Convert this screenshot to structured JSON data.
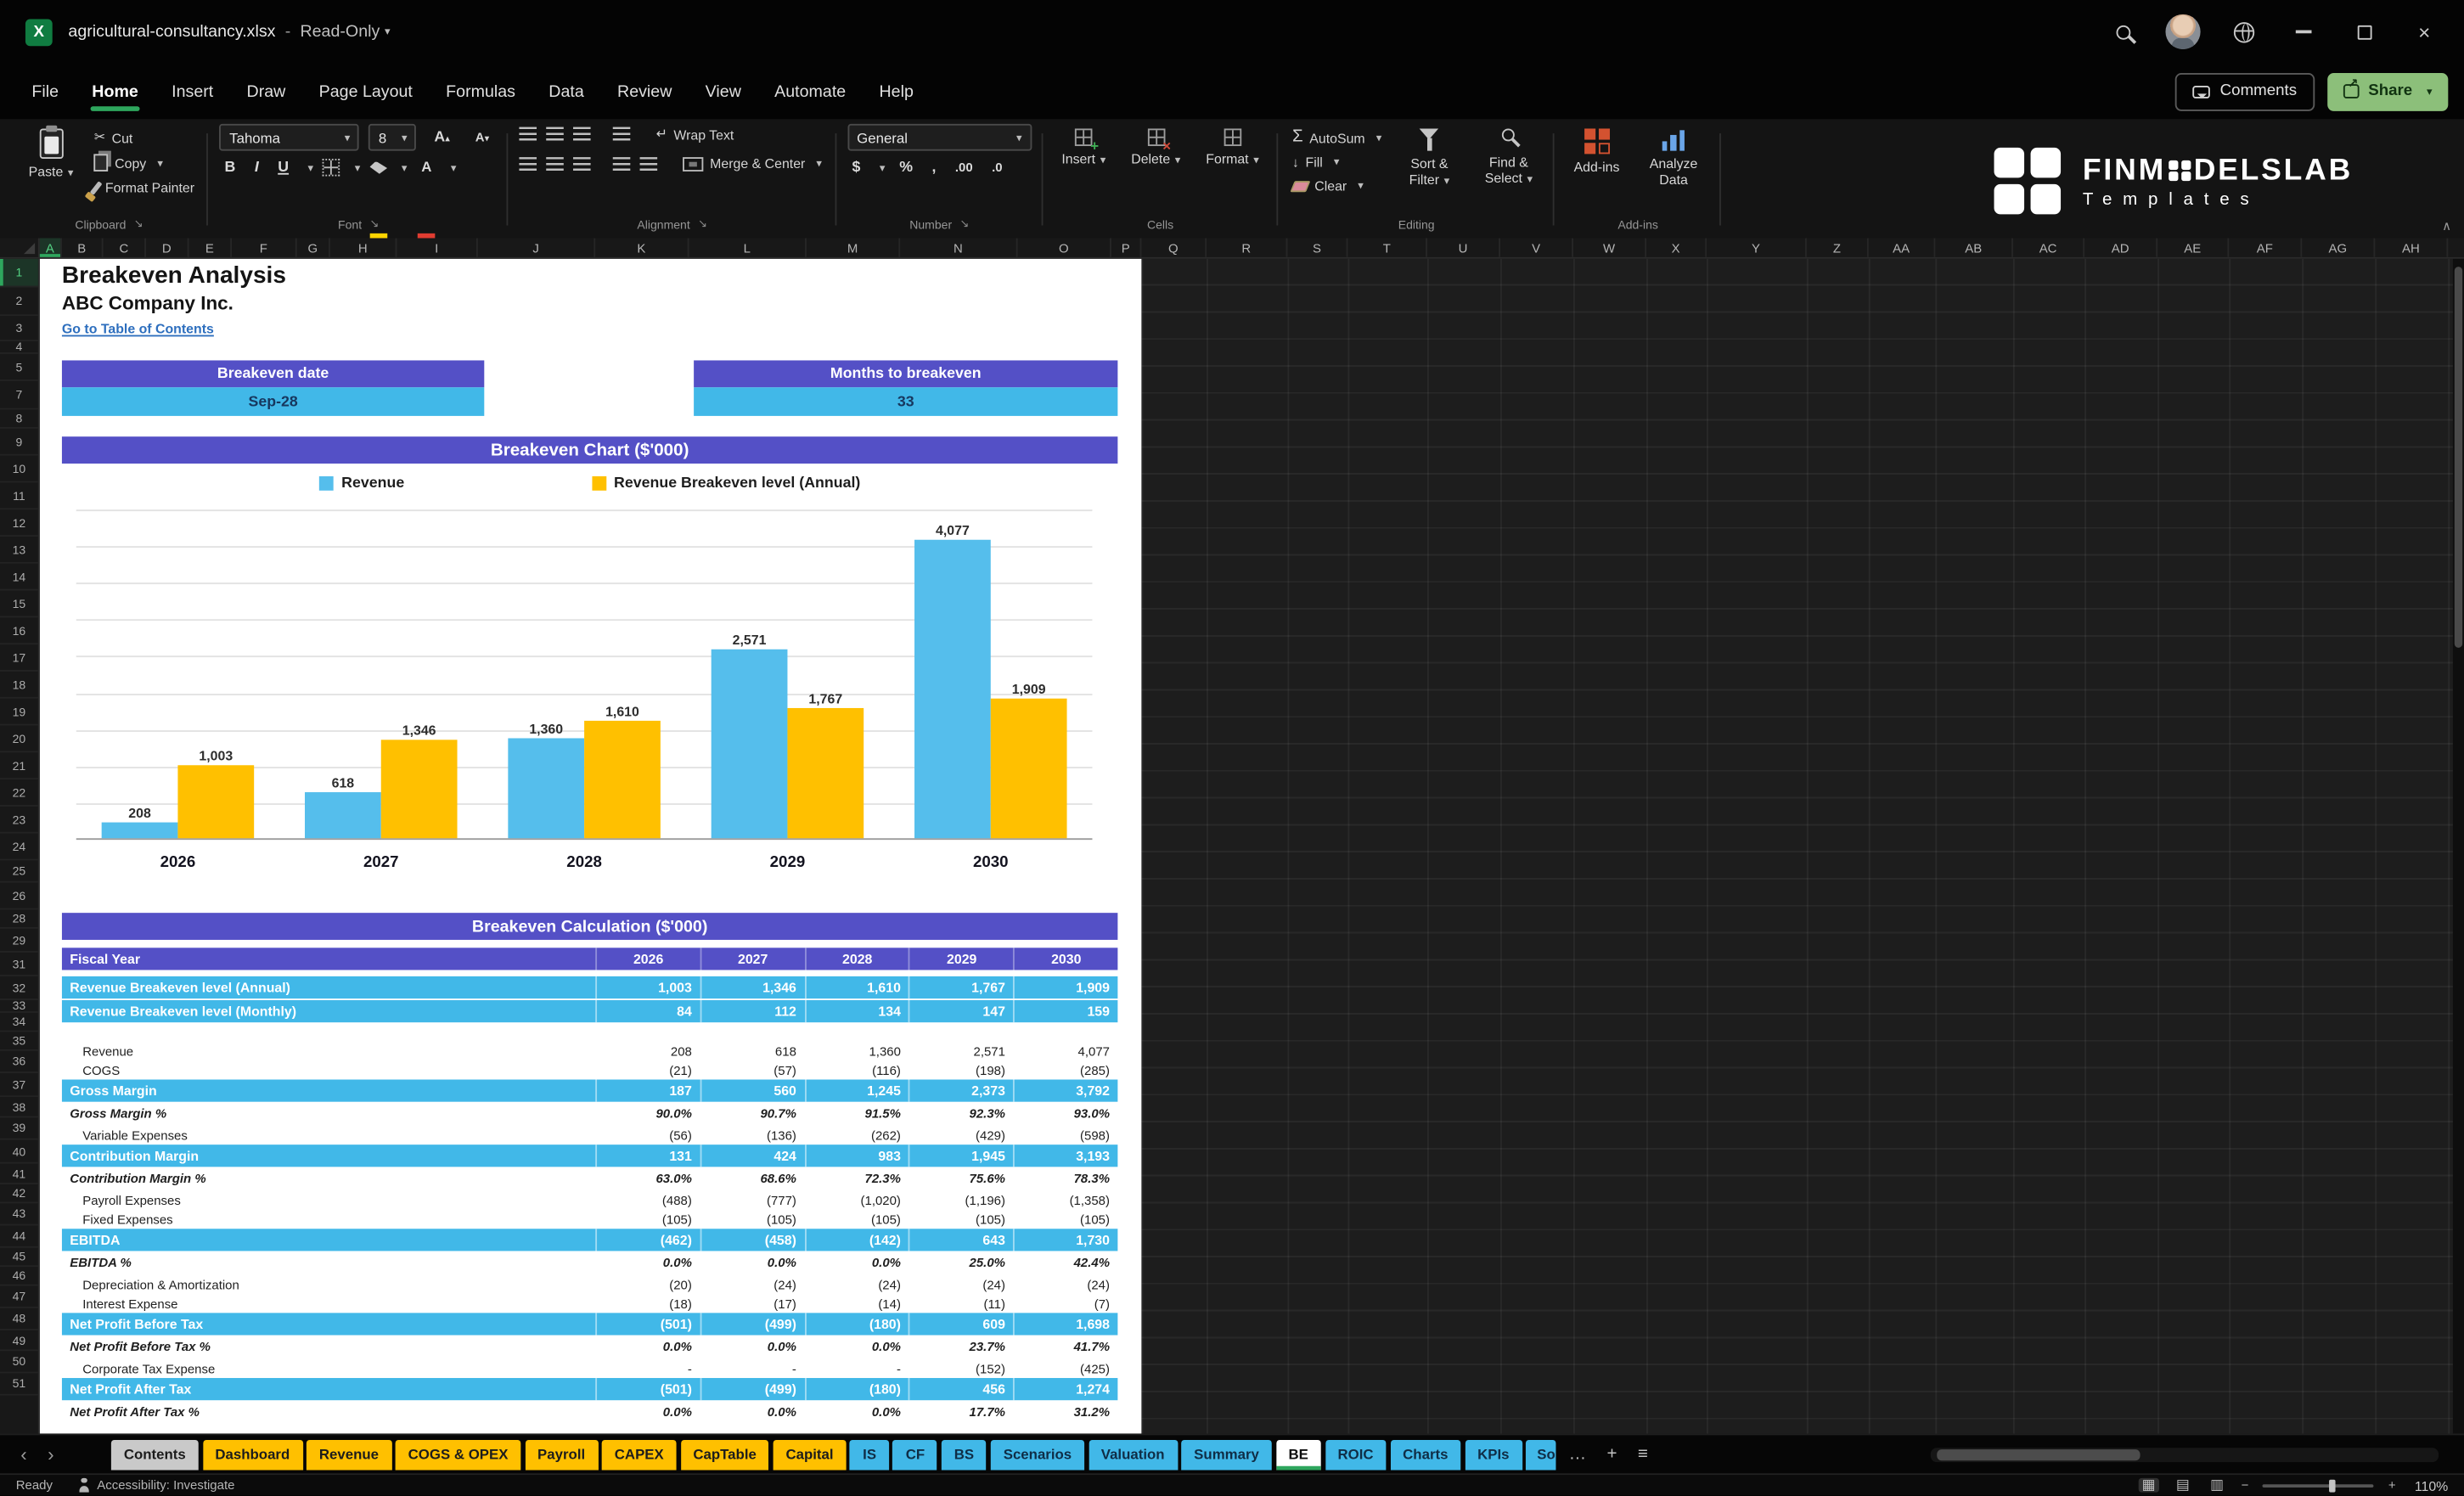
{
  "titlebar": {
    "app_icon_letter": "X",
    "filename": "agricultural-consultancy.xlsx",
    "separator": "-",
    "mode": "Read-Only"
  },
  "icons": {
    "dropdown": "▾",
    "cut": "✂",
    "autosum": "Σ",
    "fill_arrow": "↓",
    "bold": "B",
    "italic": "I",
    "underline": "U",
    "currency": "$",
    "percent": "%",
    "comma": ",",
    "decrease_decimal": ".0",
    "increase_decimal": ".00",
    "wrap_return": "↵",
    "launcher": "↘",
    "ribbon_collapse": "∧",
    "close": "×",
    "plus": "+",
    "minus": "−",
    "more_tabs": "…",
    "add_sheet": "+",
    "sheet_list": "≡",
    "nav_left": "‹",
    "nav_right": "›",
    "view_normal": "▦",
    "view_layout": "▤",
    "view_break": "▥"
  },
  "menubar": {
    "items": [
      "File",
      "Home",
      "Insert",
      "Draw",
      "Page Layout",
      "Formulas",
      "Data",
      "Review",
      "View",
      "Automate",
      "Help"
    ],
    "active": "Home",
    "comments_label": "Comments",
    "share_label": "Share"
  },
  "ribbon": {
    "clipboard": {
      "label": "Clipboard",
      "paste": "Paste",
      "cut": "Cut",
      "copy": "Copy",
      "format_painter": "Format Painter"
    },
    "font": {
      "label": "Font",
      "font_name": "Tahoma",
      "font_size": "8"
    },
    "alignment": {
      "label": "Alignment",
      "wrap_text": "Wrap Text",
      "merge_center": "Merge & Center"
    },
    "number": {
      "label": "Number",
      "format": "General"
    },
    "cells": {
      "label": "Cells",
      "insert": "Insert",
      "delete": "Delete",
      "format": "Format"
    },
    "editing": {
      "label": "Editing",
      "autosum": "AutoSum",
      "fill": "Fill",
      "clear": "Clear",
      "sort_filter": "Sort & Filter",
      "find_select": "Find & Select"
    },
    "addins": {
      "label": "Add-ins",
      "button": "Add-ins",
      "analyze": "Analyze Data"
    }
  },
  "brand": {
    "part1": "FINM",
    "part2": "DELSLAB",
    "line2": "Templates"
  },
  "grid": {
    "columns": [
      {
        "n": "A",
        "w": 14,
        "selected": true
      },
      {
        "n": "B",
        "w": 26
      },
      {
        "n": "C",
        "w": 27
      },
      {
        "n": "D",
        "w": 27
      },
      {
        "n": "E",
        "w": 27
      },
      {
        "n": "F",
        "w": 41
      },
      {
        "n": "G",
        "w": 21
      },
      {
        "n": "H",
        "w": 42
      },
      {
        "n": "I",
        "w": 51
      },
      {
        "n": "J",
        "w": 74
      },
      {
        "n": "K",
        "w": 59
      },
      {
        "n": "L",
        "w": 74
      },
      {
        "n": "M",
        "w": 59
      },
      {
        "n": "N",
        "w": 74
      },
      {
        "n": "O",
        "w": 59
      },
      {
        "n": "P",
        "w": 19
      },
      {
        "n": "Q",
        "w": 41
      },
      {
        "n": "R",
        "w": 51
      },
      {
        "n": "S",
        "w": 38
      },
      {
        "n": "T",
        "w": 50
      },
      {
        "n": "U",
        "w": 46
      },
      {
        "n": "V",
        "w": 46
      },
      {
        "n": "W",
        "w": 46
      },
      {
        "n": "X",
        "w": 38
      },
      {
        "n": "Y",
        "w": 63
      },
      {
        "n": "Z",
        "w": 39
      },
      {
        "n": "AA",
        "w": 42
      },
      {
        "n": "AB",
        "w": 49
      },
      {
        "n": "AC",
        "w": 45
      },
      {
        "n": "AD",
        "w": 46
      },
      {
        "n": "AE",
        "w": 45
      },
      {
        "n": "AF",
        "w": 46
      },
      {
        "n": "AG",
        "w": 46
      },
      {
        "n": "AH",
        "w": 46
      }
    ],
    "rows": [
      {
        "n": "1",
        "h": 18,
        "selected": true
      },
      {
        "n": "2",
        "h": 18
      },
      {
        "n": "3",
        "h": 16
      },
      {
        "n": "4",
        "h": 8
      },
      {
        "n": "5",
        "h": 17
      },
      {
        "n": "7",
        "h": 18
      },
      {
        "n": "8",
        "h": 12
      },
      {
        "n": "9",
        "h": 17
      },
      {
        "n": "10",
        "h": 17
      },
      {
        "n": "11",
        "h": 17
      },
      {
        "n": "12",
        "h": 17
      },
      {
        "n": "13",
        "h": 17
      },
      {
        "n": "14",
        "h": 17
      },
      {
        "n": "15",
        "h": 17
      },
      {
        "n": "16",
        "h": 17
      },
      {
        "n": "17",
        "h": 17
      },
      {
        "n": "18",
        "h": 17
      },
      {
        "n": "19",
        "h": 17
      },
      {
        "n": "20",
        "h": 17
      },
      {
        "n": "21",
        "h": 17
      },
      {
        "n": "22",
        "h": 17
      },
      {
        "n": "23",
        "h": 17
      },
      {
        "n": "24",
        "h": 17
      },
      {
        "n": "25",
        "h": 14
      },
      {
        "n": "26",
        "h": 17
      },
      {
        "n": "28",
        "h": 12
      },
      {
        "n": "29",
        "h": 15
      },
      {
        "n": "31",
        "h": 15
      },
      {
        "n": "32",
        "h": 15
      },
      {
        "n": "33",
        "h": 8
      },
      {
        "n": "34",
        "h": 12
      },
      {
        "n": "35",
        "h": 12
      },
      {
        "n": "36",
        "h": 14
      },
      {
        "n": "37",
        "h": 15
      },
      {
        "n": "38",
        "h": 13
      },
      {
        "n": "39",
        "h": 14
      },
      {
        "n": "40",
        "h": 15
      },
      {
        "n": "41",
        "h": 13
      },
      {
        "n": "42",
        "h": 12
      },
      {
        "n": "43",
        "h": 14
      },
      {
        "n": "44",
        "h": 14
      },
      {
        "n": "45",
        "h": 12
      },
      {
        "n": "46",
        "h": 12
      },
      {
        "n": "47",
        "h": 14
      },
      {
        "n": "48",
        "h": 14
      },
      {
        "n": "49",
        "h": 13
      },
      {
        "n": "50",
        "h": 14
      },
      {
        "n": "51",
        "h": 14
      }
    ]
  },
  "sheet": {
    "title": "Breakeven Analysis",
    "company": "ABC Company Inc.",
    "link": "Go to Table of Contents",
    "breakeven_date_label": "Breakeven date",
    "breakeven_date_value": "Sep-28",
    "months_label": "Months to breakeven",
    "months_value": "33"
  },
  "chart_data": {
    "type": "bar",
    "title": "Breakeven Chart ($'000)",
    "categories": [
      "2026",
      "2027",
      "2028",
      "2029",
      "2030"
    ],
    "series": [
      {
        "name": "Revenue",
        "color": "#55beec",
        "values": [
          208,
          618,
          1360,
          2571,
          4077
        ],
        "labels": [
          "208",
          "618",
          "1,360",
          "2,571",
          "4,077"
        ]
      },
      {
        "name": "Revenue Breakeven level (Annual)",
        "color": "#ffc000",
        "values": [
          1003,
          1346,
          1610,
          1767,
          1909
        ],
        "labels": [
          "1,003",
          "1,346",
          "1,610",
          "1,767",
          "1,909"
        ]
      }
    ],
    "xlabel": "",
    "ylabel": "",
    "ylim": [
      0,
      4500
    ],
    "grid_step": 500,
    "grid": true,
    "legend_position": "top"
  },
  "calc_table": {
    "title": "Breakeven Calculation ($'000)",
    "header": [
      "Fiscal Year",
      "2026",
      "2027",
      "2028",
      "2029",
      "2030"
    ],
    "rows": [
      {
        "label": "Revenue Breakeven level (Annual)",
        "values": [
          "1,003",
          "1,346",
          "1,610",
          "1,767",
          "1,909"
        ],
        "style": "band"
      },
      {
        "label": "Revenue Breakeven level (Monthly)",
        "values": [
          "84",
          "112",
          "134",
          "147",
          "159"
        ],
        "style": "band",
        "gap_after": true
      },
      {
        "label": "Revenue",
        "values": [
          "208",
          "618",
          "1,360",
          "2,571",
          "4,077"
        ],
        "style": "plain"
      },
      {
        "label": "COGS",
        "values": [
          "(21)",
          "(57)",
          "(116)",
          "(198)",
          "(285)"
        ],
        "style": "plain"
      },
      {
        "label": "Gross Margin",
        "values": [
          "187",
          "560",
          "1,245",
          "2,373",
          "3,792"
        ],
        "style": "band"
      },
      {
        "label": "Gross Margin %",
        "values": [
          "90.0%",
          "90.7%",
          "91.5%",
          "92.3%",
          "93.0%"
        ],
        "style": "pct"
      },
      {
        "label": "Variable Expenses",
        "values": [
          "(56)",
          "(136)",
          "(262)",
          "(429)",
          "(598)"
        ],
        "style": "plain"
      },
      {
        "label": "Contribution Margin",
        "values": [
          "131",
          "424",
          "983",
          "1,945",
          "3,193"
        ],
        "style": "band"
      },
      {
        "label": "Contribution Margin %",
        "values": [
          "63.0%",
          "68.6%",
          "72.3%",
          "75.6%",
          "78.3%"
        ],
        "style": "pct"
      },
      {
        "label": "Payroll Expenses",
        "values": [
          "(488)",
          "(777)",
          "(1,020)",
          "(1,196)",
          "(1,358)"
        ],
        "style": "plain"
      },
      {
        "label": "Fixed Expenses",
        "values": [
          "(105)",
          "(105)",
          "(105)",
          "(105)",
          "(105)"
        ],
        "style": "plain"
      },
      {
        "label": "EBITDA",
        "values": [
          "(462)",
          "(458)",
          "(142)",
          "643",
          "1,730"
        ],
        "style": "band"
      },
      {
        "label": "EBITDA %",
        "values": [
          "0.0%",
          "0.0%",
          "0.0%",
          "25.0%",
          "42.4%"
        ],
        "style": "pct"
      },
      {
        "label": "Depreciation & Amortization",
        "values": [
          "(20)",
          "(24)",
          "(24)",
          "(24)",
          "(24)"
        ],
        "style": "plain"
      },
      {
        "label": "Interest Expense",
        "values": [
          "(18)",
          "(17)",
          "(14)",
          "(11)",
          "(7)"
        ],
        "style": "plain"
      },
      {
        "label": "Net Profit Before Tax",
        "values": [
          "(501)",
          "(499)",
          "(180)",
          "609",
          "1,698"
        ],
        "style": "band"
      },
      {
        "label": "Net Profit Before Tax %",
        "values": [
          "0.0%",
          "0.0%",
          "0.0%",
          "23.7%",
          "41.7%"
        ],
        "style": "pct"
      },
      {
        "label": "Corporate Tax Expense",
        "values": [
          "-",
          "-",
          "-",
          "(152)",
          "(425)"
        ],
        "style": "plain"
      },
      {
        "label": "Net Profit After Tax",
        "values": [
          "(501)",
          "(499)",
          "(180)",
          "456",
          "1,274"
        ],
        "style": "band"
      },
      {
        "label": "Net Profit After Tax %",
        "values": [
          "0.0%",
          "0.0%",
          "0.0%",
          "17.7%",
          "31.2%"
        ],
        "style": "pct"
      }
    ]
  },
  "tabs": {
    "items": [
      {
        "label": "Contents",
        "color": "gray"
      },
      {
        "label": "Dashboard",
        "color": "yellow"
      },
      {
        "label": "Revenue",
        "color": "yellow"
      },
      {
        "label": "COGS & OPEX",
        "color": "yellow"
      },
      {
        "label": "Payroll",
        "color": "yellow"
      },
      {
        "label": "CAPEX",
        "color": "yellow"
      },
      {
        "label": "CapTable",
        "color": "yellow"
      },
      {
        "label": "Capital",
        "color": "yellow"
      },
      {
        "label": "IS",
        "color": "blue"
      },
      {
        "label": "CF",
        "color": "blue"
      },
      {
        "label": "BS",
        "color": "blue"
      },
      {
        "label": "Scenarios",
        "color": "blue"
      },
      {
        "label": "Valuation",
        "color": "blue"
      },
      {
        "label": "Summary",
        "color": "blue"
      },
      {
        "label": "BE",
        "color": "active"
      },
      {
        "label": "ROIC",
        "color": "blue"
      },
      {
        "label": "Charts",
        "color": "blue"
      },
      {
        "label": "KPIs",
        "color": "blue"
      },
      {
        "label": "So",
        "color": "blue",
        "clipped": true
      }
    ]
  },
  "statusbar": {
    "ready": "Ready",
    "accessibility": "Accessibility: Investigate",
    "zoom": "110%"
  },
  "colors": {
    "header_purple": "#5450c6",
    "band_blue": "#41b8e8",
    "bar_blue": "#55beec",
    "bar_yellow": "#ffc000",
    "accent_green": "#2ea65d",
    "excel_green": "#107c41"
  }
}
